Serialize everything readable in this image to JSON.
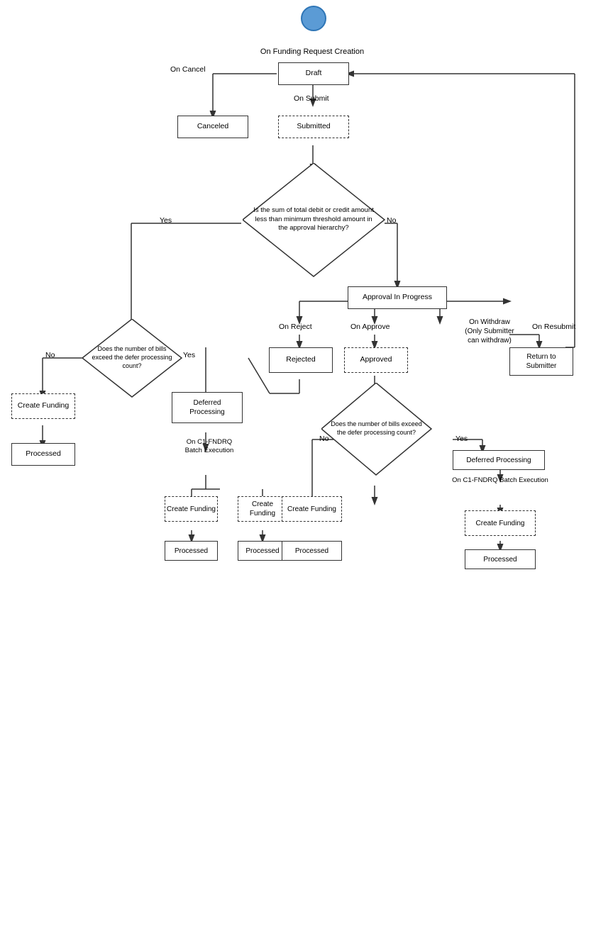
{
  "nodes": {
    "start_circle": {
      "label": ""
    },
    "on_funding_request_creation": {
      "label": "On Funding Request Creation"
    },
    "draft": {
      "label": "Draft"
    },
    "on_cancel": {
      "label": "On Cancel"
    },
    "canceled": {
      "label": "Canceled"
    },
    "on_submit": {
      "label": "On Submit"
    },
    "submitted": {
      "label": "Submitted"
    },
    "diamond1": {
      "label": "Is the sum of total debit or credit amount less than minimum threshold amount in the approval hierarchy?"
    },
    "yes1": {
      "label": "Yes"
    },
    "no1": {
      "label": "No"
    },
    "approval_in_progress": {
      "label": "Approval In Progress"
    },
    "on_reject": {
      "label": "On Reject"
    },
    "rejected": {
      "label": "Rejected"
    },
    "on_approve": {
      "label": "On Approve"
    },
    "approved": {
      "label": "Approved"
    },
    "on_withdraw": {
      "label": "On Withdraw\n(Only Submitter\ncan withdraw)"
    },
    "return_to_submitter": {
      "label": "Return to\nSubmitter"
    },
    "on_resubmit": {
      "label": "On Resubmit"
    },
    "diamond2": {
      "label": "Does the number of bills exceed the defer processing count?"
    },
    "no2": {
      "label": "No"
    },
    "create_funding1": {
      "label": "Create Funding"
    },
    "processed1": {
      "label": "Processed"
    },
    "yes2": {
      "label": "Yes"
    },
    "deferred_processing1": {
      "label": "Deferred\nProcessing"
    },
    "on_c1_batch1": {
      "label": "On C1-FNDRQ\nBatch Execution"
    },
    "create_funding2": {
      "label": "Create\nFunding"
    },
    "processed2": {
      "label": "Processed"
    },
    "create_funding3": {
      "label": "Create\nFunding"
    },
    "processed3": {
      "label": "Processed"
    },
    "diamond3": {
      "label": "Does the number of bills exceed the defer processing count?"
    },
    "yes3": {
      "label": "Yes"
    },
    "no3": {
      "label": "No"
    },
    "deferred_processing2": {
      "label": "Deferred Processing"
    },
    "on_c1_batch2": {
      "label": "On C1-FNDRQ Batch Execution"
    },
    "create_funding4": {
      "label": "Create Funding"
    },
    "processed4": {
      "label": "Processed"
    }
  }
}
